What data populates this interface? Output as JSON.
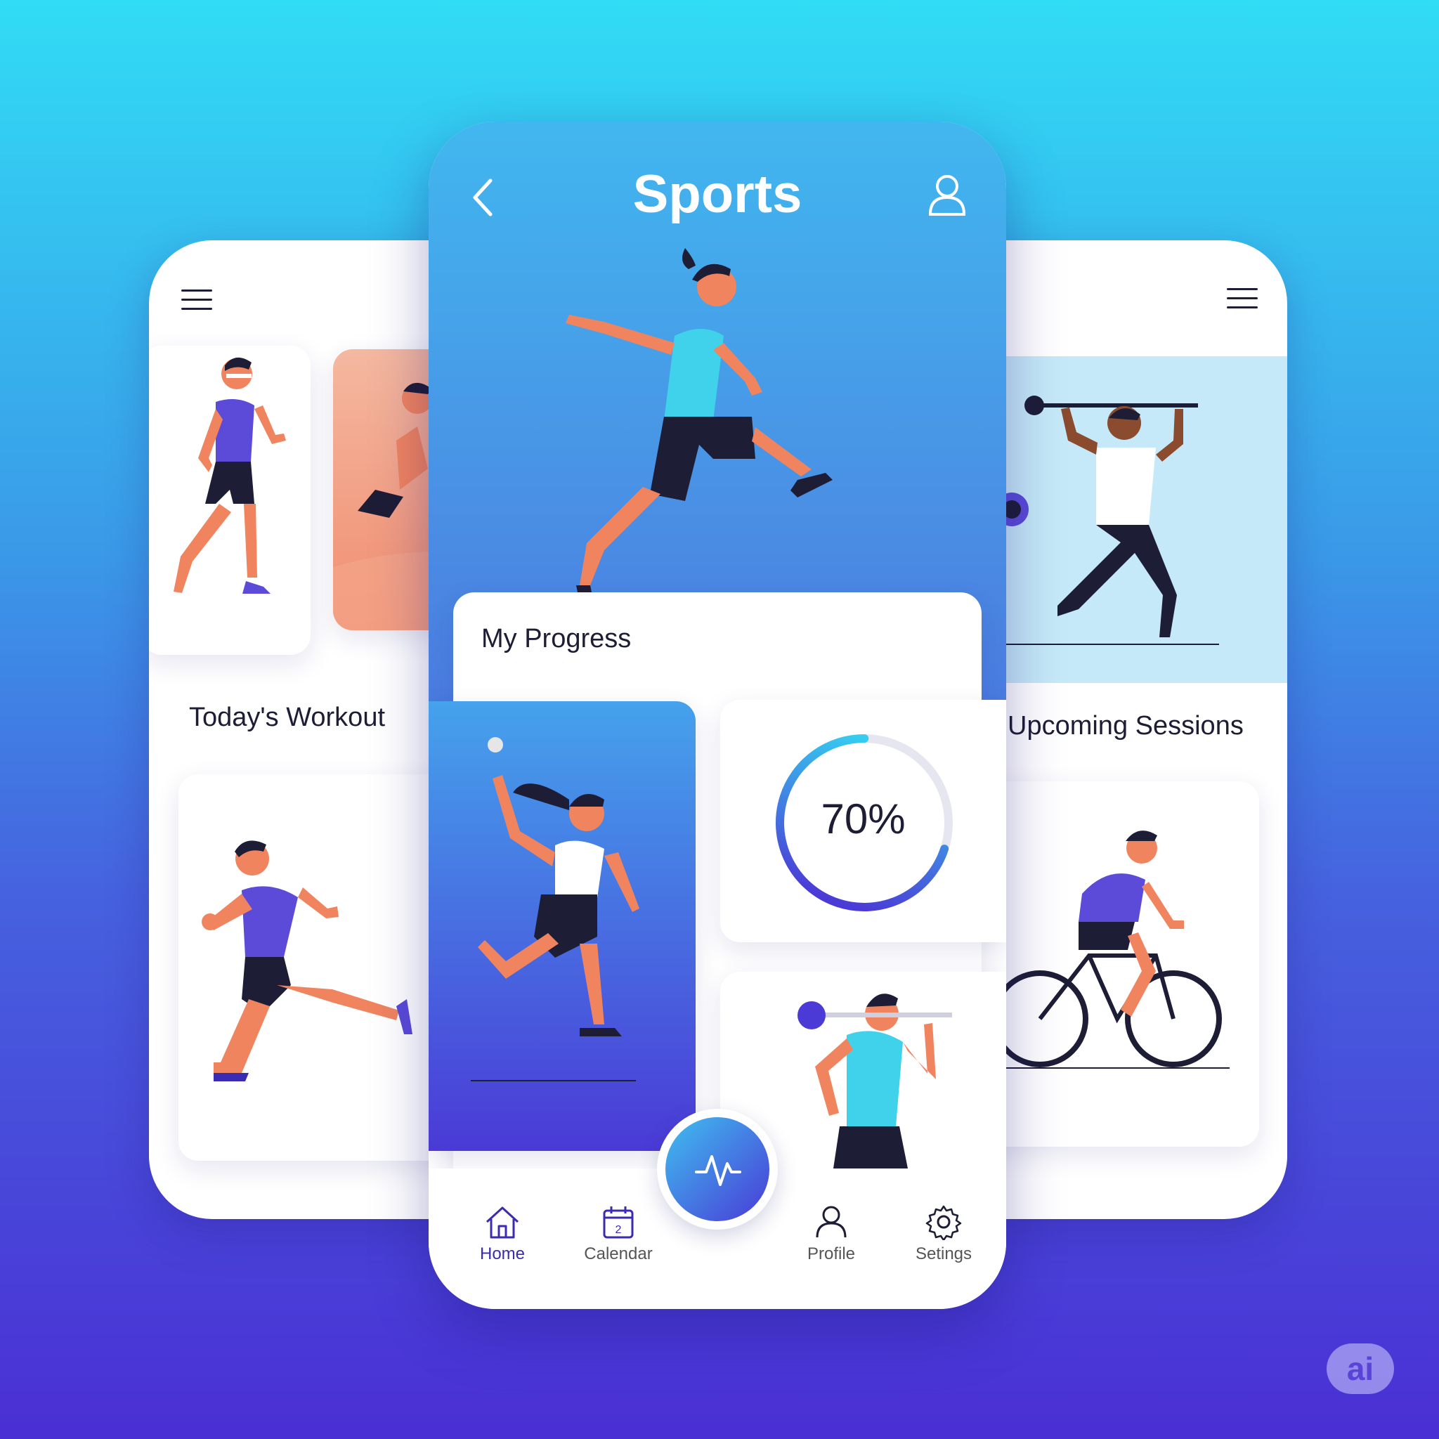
{
  "center": {
    "title": "Sports",
    "progress_heading": "My Progress",
    "progress_percent_label": "70%",
    "progress_value": 0.7,
    "nav": [
      {
        "label": "Home",
        "icon": "home-icon"
      },
      {
        "label": "Calendar",
        "icon": "calendar-icon",
        "badge": "2"
      },
      {
        "label": "Profile",
        "icon": "user-icon"
      },
      {
        "label": "Setings",
        "icon": "gear-icon"
      }
    ],
    "fab_icon": "pulse-icon"
  },
  "left": {
    "heading": "Today's Workout"
  },
  "right": {
    "heading": "Upcoming Sessions"
  },
  "watermark": "ai",
  "colors": {
    "accent": "#4b3ad6",
    "cyan": "#35d0f0",
    "navy": "#1d1d36",
    "skin": "#f0845f",
    "shirt_purple": "#5b4bd8",
    "shirt_cyan": "#3fd2ea"
  }
}
